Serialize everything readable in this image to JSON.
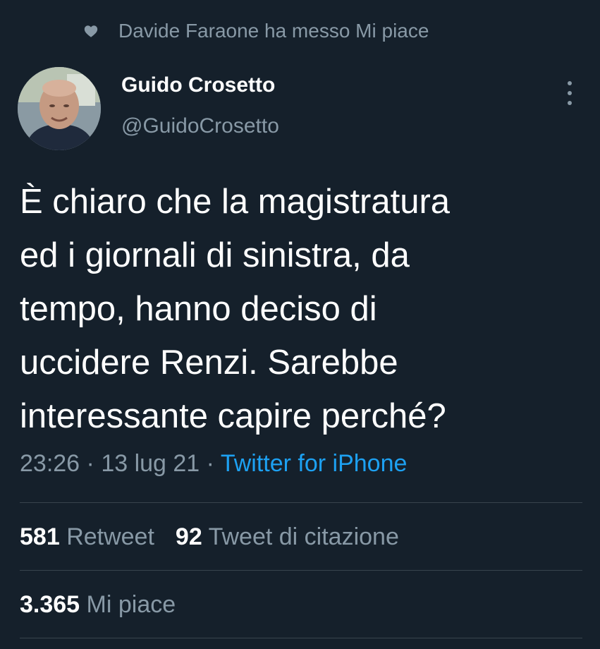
{
  "social_context": {
    "icon": "heart-icon",
    "text": "Davide Faraone ha messo Mi piace"
  },
  "author": {
    "name": "Guido Crosetto",
    "handle": "@GuidoCrosetto"
  },
  "tweet": {
    "text": "È chiaro che la magistratura\ned i giornali di sinistra, da\ntempo, hanno deciso di\nuccidere Renzi. Sarebbe\ninteressante capire perché?",
    "time": "23:26",
    "separator": " · ",
    "date": "13 lug 21",
    "source": "Twitter for iPhone"
  },
  "stats": {
    "retweets_count": "581",
    "retweets_label": "Retweet",
    "quotes_count": "92",
    "quotes_label": "Tweet di citazione",
    "likes_count": "3.365",
    "likes_label": "Mi piace"
  },
  "colors": {
    "background": "#15202b",
    "secondary_text": "#8899a6",
    "link": "#1da1f2",
    "divider": "#38444d"
  }
}
